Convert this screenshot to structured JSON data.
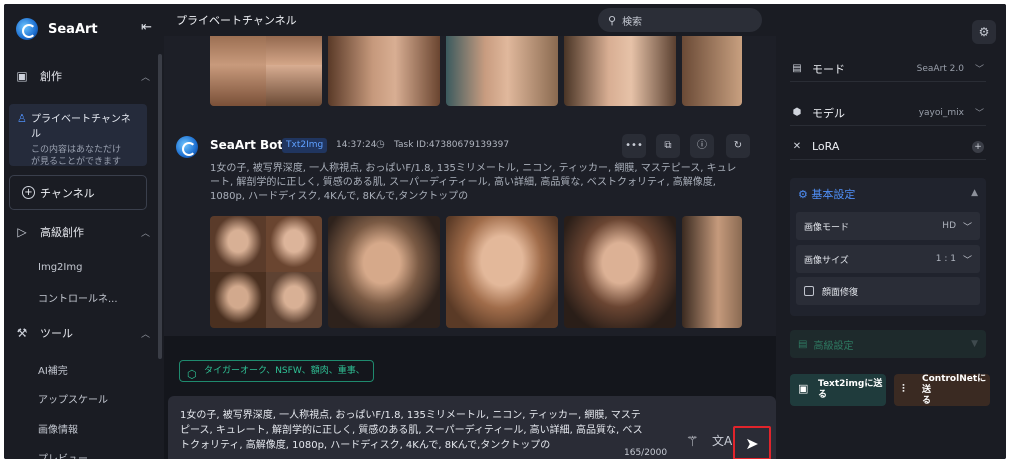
{
  "app": {
    "name": "SeaArt"
  },
  "sidebar": {
    "create": "創作",
    "private_channel": {
      "title": "プライベートチャンネル",
      "desc_line1": "この内容はあなただけ",
      "desc_line2": "が見ることができます"
    },
    "channel_button": "チャンネル",
    "advanced": "高級創作",
    "img2img": "Img2Img",
    "controlnet": "コントロールネ...",
    "tools": "ツール",
    "tool_items": [
      "AI補完",
      "アップスケール",
      "画像情報",
      "プレビュー"
    ]
  },
  "header": {
    "title": "プライベートチャンネル",
    "search_placeholder": "検索"
  },
  "message": {
    "bot_name": "SeaArt Bot",
    "tag": "Txt2Img",
    "time": "14:37:24",
    "task_id": "Task ID:47380679139397",
    "prompt": "1女の子, 被写界深度, 一人称視点, おっぱいF/1.8, 135ミリメートル, ニコン, ティッカー, 網膜, マステピース, キュレート, 解剖学的に正しく, 質感のある肌, スーパーディティール, 高い詳細, 高品質な, ベストクォリティ, 高解像度, 1080p, ハードディスク, 4Kんで, 8Kんで,タンクトップの"
  },
  "input": {
    "chip": "タイガーオーク、NSFW、額肉、重事、",
    "text": "1女の子, 被写界深度, 一人称視点, おっぱいF/1.8, 135ミリメートル, ニコン, ティッカー, 網膜, マステピース, キュレート, 解剖学的に正しく, 質感のある肌, スーパーディティール, 高い詳細, 高品質な, ベストクォリティ, 高解像度, 1080p, ハードディスク, 4Kんで, 8Kんで,タンクトップの",
    "counter": "165/2000"
  },
  "right_panel": {
    "mode_label": "モード",
    "mode_value": "SeaArt 2.0",
    "model_label": "モデル",
    "model_value": "yayoi_mix",
    "lora_label": "LoRA",
    "basic_settings": "基本設定",
    "image_mode_label": "画像モード",
    "image_mode_value": "HD",
    "image_size_label": "画像サイズ",
    "image_size_value": "1 : 1",
    "face_fix_label": "顔面修復",
    "advanced_settings": "高級設定",
    "send_txt2img": "Text2imgに送る",
    "send_controlnet_line1": "ControlNetに送",
    "send_controlnet_line2": "る"
  },
  "colors": {
    "accent": "#4f8ff7",
    "highlight": "#e1242b",
    "chip": "#2fc396"
  }
}
